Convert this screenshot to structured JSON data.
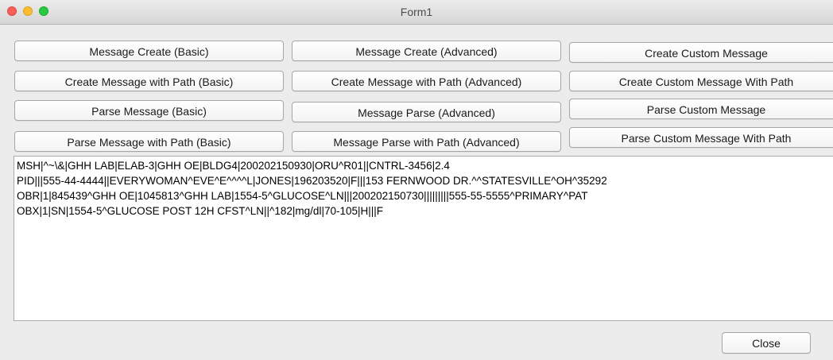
{
  "window": {
    "title": "Form1"
  },
  "buttons": {
    "message_create_basic": "Message Create (Basic)",
    "message_create_advanced": "Message Create (Advanced)",
    "create_custom_message": "Create Custom Message",
    "create_message_path_basic": "Create Message with Path (Basic)",
    "create_message_path_advanced": "Create Message with Path (Advanced)",
    "create_custom_message_path": "Create Custom Message With Path",
    "parse_message_basic": "Parse Message (Basic)",
    "message_parse_advanced": "Message Parse (Advanced)",
    "parse_custom_message": "Parse Custom Message",
    "parse_message_path_basic": "Parse Message with Path (Basic)",
    "message_parse_path_advanced": "Message Parse with Path (Advanced)",
    "parse_custom_message_path": "Parse Custom Message With Path",
    "close": "Close"
  },
  "output": {
    "lines": [
      "MSH|^~\\&|GHH LAB|ELAB-3|GHH OE|BLDG4|200202150930|ORU^R01||CNTRL-3456|2.4",
      "PID|||555-44-4444||EVERYWOMAN^EVE^E^^^^L|JONES|196203520|F|||153 FERNWOOD DR.^^STATESVILLE^OH^35292",
      "OBR|1|845439^GHH OE|1045813^GHH LAB|1554-5^GLUCOSE^LN|||200202150730|||||||||555-55-5555^PRIMARY^PAT",
      "OBX|1|SN|1554-5^GLUCOSE POST 12H CFST^LN||^182|mg/dl|70-105|H|||F"
    ]
  },
  "colors": {
    "close_light": "#fc5f57",
    "minimize_light": "#fdbd2f",
    "maximize_light": "#29c941"
  }
}
